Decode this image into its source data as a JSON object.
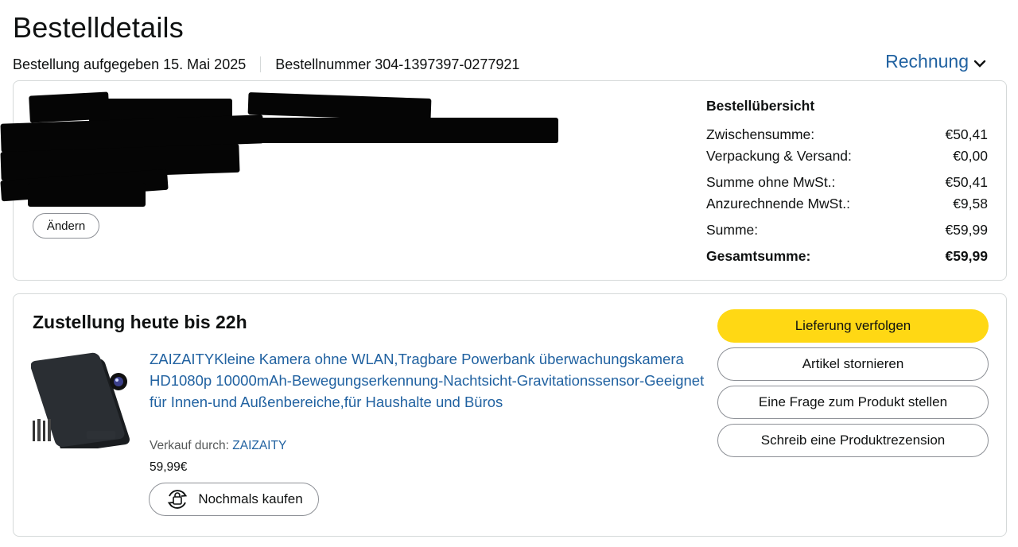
{
  "page": {
    "title": "Bestelldetails"
  },
  "order_meta": {
    "placed": "Bestellung aufgegeben 15. Mai 2025",
    "number": "Bestellnummer 304-1397397-0277921"
  },
  "invoice": {
    "label": "Rechnung",
    "icon": "chevron-down-icon"
  },
  "shipping_address": {
    "redacted": true,
    "change_label": "Ändern"
  },
  "summary": {
    "title": "Bestellübersicht",
    "rows": [
      {
        "label": "Zwischensumme:",
        "value": "€50,41"
      },
      {
        "label": "Verpackung & Versand:",
        "value": "€0,00"
      },
      {
        "label": "Summe ohne MwSt.:",
        "value": "€50,41"
      },
      {
        "label": "Anzurechnende MwSt.:",
        "value": "€9,58"
      },
      {
        "label": "Summe:",
        "value": "€59,99"
      },
      {
        "label": "Gesamtsumme:",
        "value": "€59,99"
      }
    ]
  },
  "delivery": {
    "heading": "Zustellung heute bis 22h",
    "product": {
      "title": "ZAIZAITYKleine Kamera ohne WLAN,Tragbare Powerbank überwachungskamera HD1080p 10000mAh-Bewegungserkennung-Nachtsicht-Gravitationssensor-Geeignet für Innen-und Außenbereiche,für Haushalte und Büros",
      "sold_by_label": "Verkauf durch:",
      "seller": "ZAIZAITY",
      "price": "59,99€",
      "buy_again_label": "Nochmals kaufen"
    },
    "actions": {
      "track": "Lieferung verfolgen",
      "cancel": "Artikel stornieren",
      "question": "Eine Frage zum Produkt stellen",
      "review": "Schreib eine Produktrezension"
    }
  },
  "colors": {
    "accent": "#2162a1",
    "primary_button": "#ffd814",
    "border": "#d5d9d9"
  }
}
